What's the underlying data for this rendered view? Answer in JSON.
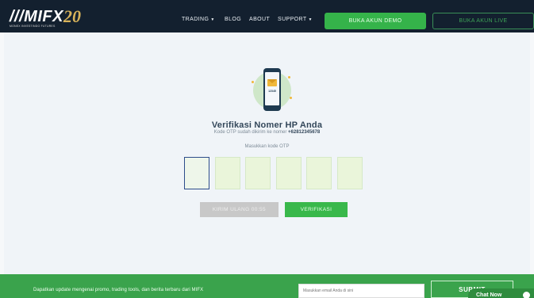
{
  "brand": {
    "logo_text": "MIFX",
    "logo_tagline": "MONEX INVESTINDO FUTURES",
    "anniversary": "20"
  },
  "nav": {
    "items": [
      {
        "label": "TRADING",
        "has_dropdown": true
      },
      {
        "label": "BLOG",
        "has_dropdown": false
      },
      {
        "label": "ABOUT",
        "has_dropdown": false
      },
      {
        "label": "SUPPORT",
        "has_dropdown": true
      }
    ],
    "demo_button": "BUKA AKUN DEMO",
    "live_button": "BUKA AKUN LIVE"
  },
  "verify": {
    "illustration_number": "12345",
    "title": "Verifikasi Nomer HP Anda",
    "subtitle_prefix": "Kode OTP sudah dikirim ke nomer ",
    "phone_number": "+62812345678",
    "prompt": "Masukkan kode OTP",
    "otp_boxes": [
      "",
      "",
      "",
      "",
      "",
      ""
    ],
    "resend_button": "KIRIM ULANG 00:55",
    "verify_button": "VERIFIKASI"
  },
  "footer": {
    "newsletter_text": "Dapatkan update mengenai promo, trading tools, dan berita terbaru dari MIFX",
    "email_placeholder": "Masukkan email Anda di sini",
    "submit_button": "SUBMIT",
    "chat_label": "Chat Now"
  },
  "colors": {
    "navbar": "#13202f",
    "accent_green": "#35b34a",
    "otp_fill": "#eaf5da",
    "active_border": "#2c4c8a"
  }
}
